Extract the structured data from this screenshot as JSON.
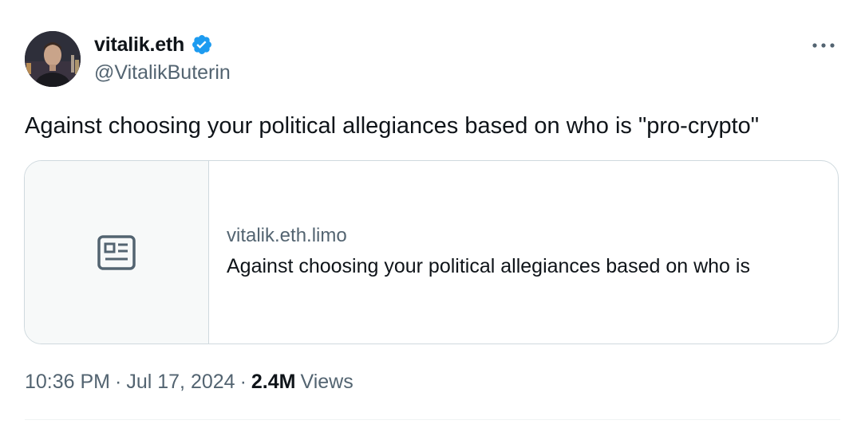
{
  "author": {
    "display_name": "vitalik.eth",
    "handle": "@VitalikButerin",
    "verified": true,
    "avatar_icon": "profile-photo"
  },
  "tweet": {
    "text": "Against choosing your political allegiances based on who is \"pro-crypto\""
  },
  "link_card": {
    "thumbnail_icon": "article-icon",
    "domain": "vitalik.eth.limo",
    "title": "Against choosing your political allegiances based on who is"
  },
  "meta": {
    "time": "10:36 PM",
    "separator": "·",
    "date": "Jul 17, 2024",
    "views_count": "2.4M",
    "views_label": "Views"
  },
  "colors": {
    "primary_text": "#0f1419",
    "secondary_text": "#536471",
    "verified_blue": "#1d9bf0",
    "card_border": "#cfd9de",
    "card_thumb_bg": "#f7f9f9"
  },
  "icons": {
    "more": "more-horizontal-icon",
    "verified": "verified-badge-icon"
  }
}
